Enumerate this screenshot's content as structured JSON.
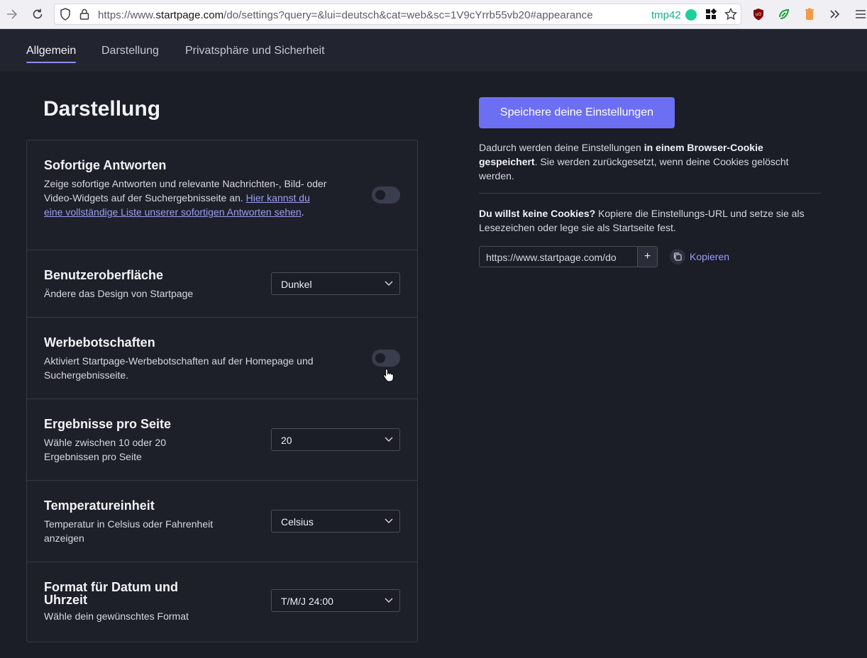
{
  "browser": {
    "url_prefix": "https://www.",
    "url_domain": "startpage.com",
    "url_rest": "/do/settings?query=&lui=deutsch&cat=web&sc=1V9cYrrb55vb20#appearance",
    "container_label": "tmp42",
    "icons": [
      "back-icon",
      "reload-icon",
      "shield-icon",
      "lock-icon",
      "extensions-icon",
      "bookmark-star-icon",
      "ublock-icon",
      "extension-green-icon",
      "extension-trash-icon",
      "overflow-icon",
      "menu-icon"
    ]
  },
  "nav": {
    "tabs": [
      {
        "label": "Allgemein",
        "active": true
      },
      {
        "label": "Darstellung",
        "active": false
      },
      {
        "label": "Privatsphäre und Sicherheit",
        "active": false
      }
    ]
  },
  "page": {
    "title": "Darstellung"
  },
  "settings": {
    "instant_answers": {
      "title": "Sofortige Antworten",
      "desc": "Zeige sofortige Antworten und relevante Nachrichten-, Bild- oder Video-Widgets auf der Suchergebnisseite an.",
      "link": "Hier kannst du eine vollständige Liste unserer sofortigen Antworten sehen",
      "link_suffix": ".",
      "enabled": false
    },
    "ui": {
      "title": "Benutzeroberfläche",
      "desc": "Ändere das Design von Startpage",
      "value": "Dunkel"
    },
    "ads": {
      "title": "Werbebotschaften",
      "desc": "Aktiviert Startpage-Werbebotschaften auf der Homepage und Suchergebnisseite.",
      "enabled": false
    },
    "results": {
      "title": "Ergebnisse pro Seite",
      "desc": "Wähle zwischen 10 oder 20 Ergebnissen pro Seite",
      "value": "20"
    },
    "temperature": {
      "title": "Temperatureinheit",
      "desc": "Temperatur in Celsius oder Fahrenheit anzeigen",
      "value": "Celsius"
    },
    "datetime": {
      "title": "Format für Datum und Uhrzeit",
      "desc": "Wähle dein gewünschtes Format",
      "value": "T/M/J 24:00"
    }
  },
  "sidebar": {
    "save_label": "Speichere deine Einstellungen",
    "cookie_text_1": "Dadurch werden deine Einstellungen ",
    "cookie_text_bold": "in einem Browser-Cookie gespeichert",
    "cookie_text_2": ". Sie werden zurückgesetzt, wenn deine Cookies gelöscht werden.",
    "no_cookie_bold": "Du willst keine Cookies?",
    "no_cookie_text": " Kopiere die Einstellungs-URL und setze sie als Lesezeichen oder lege sie als Startseite fest.",
    "settings_url": "https://www.startpage.com/do",
    "copy_label": "Kopieren"
  },
  "colors": {
    "accent": "#6d6ff2",
    "link": "#9b9df5",
    "background": "#1b1d27"
  }
}
